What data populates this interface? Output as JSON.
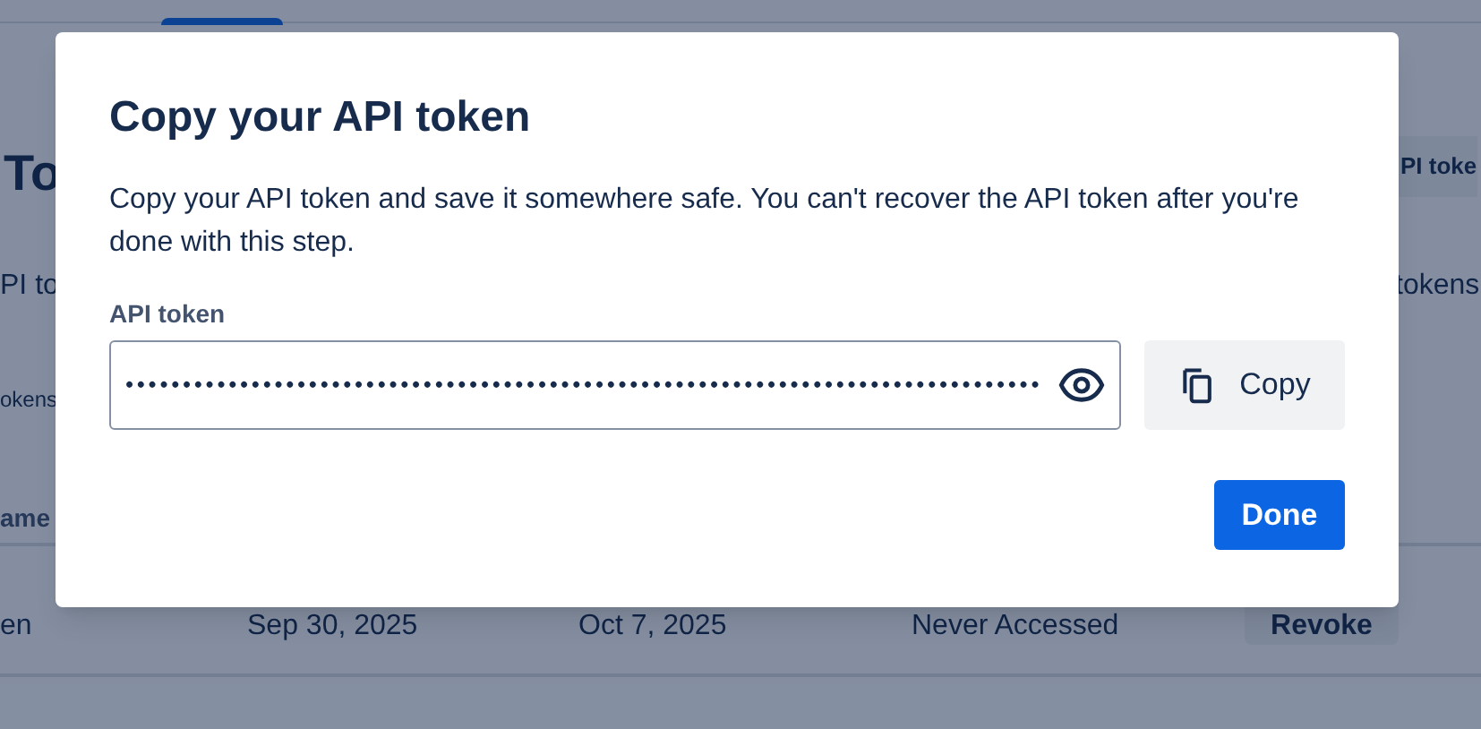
{
  "background": {
    "heading": "To",
    "create_button": "PI toke",
    "description_left": "PI to",
    "description_right": "tokens",
    "subheading": "okens",
    "column_header": "ame",
    "row": {
      "name": "en",
      "created": "Sep 30, 2025",
      "expires": "Oct 7, 2025",
      "last_accessed": "Never Accessed",
      "action": "Revoke"
    }
  },
  "dialog": {
    "title": "Copy your API token",
    "message": "Copy your API token and save it somewhere safe. You can't recover the API token after you're done with this step.",
    "field_label": "API token",
    "token_value": "••••••••••••••••••••••••••••••••••••••••••••••••••••••••••••••••••••••••••••••••",
    "copy_button": "Copy",
    "done_button": "Done"
  }
}
